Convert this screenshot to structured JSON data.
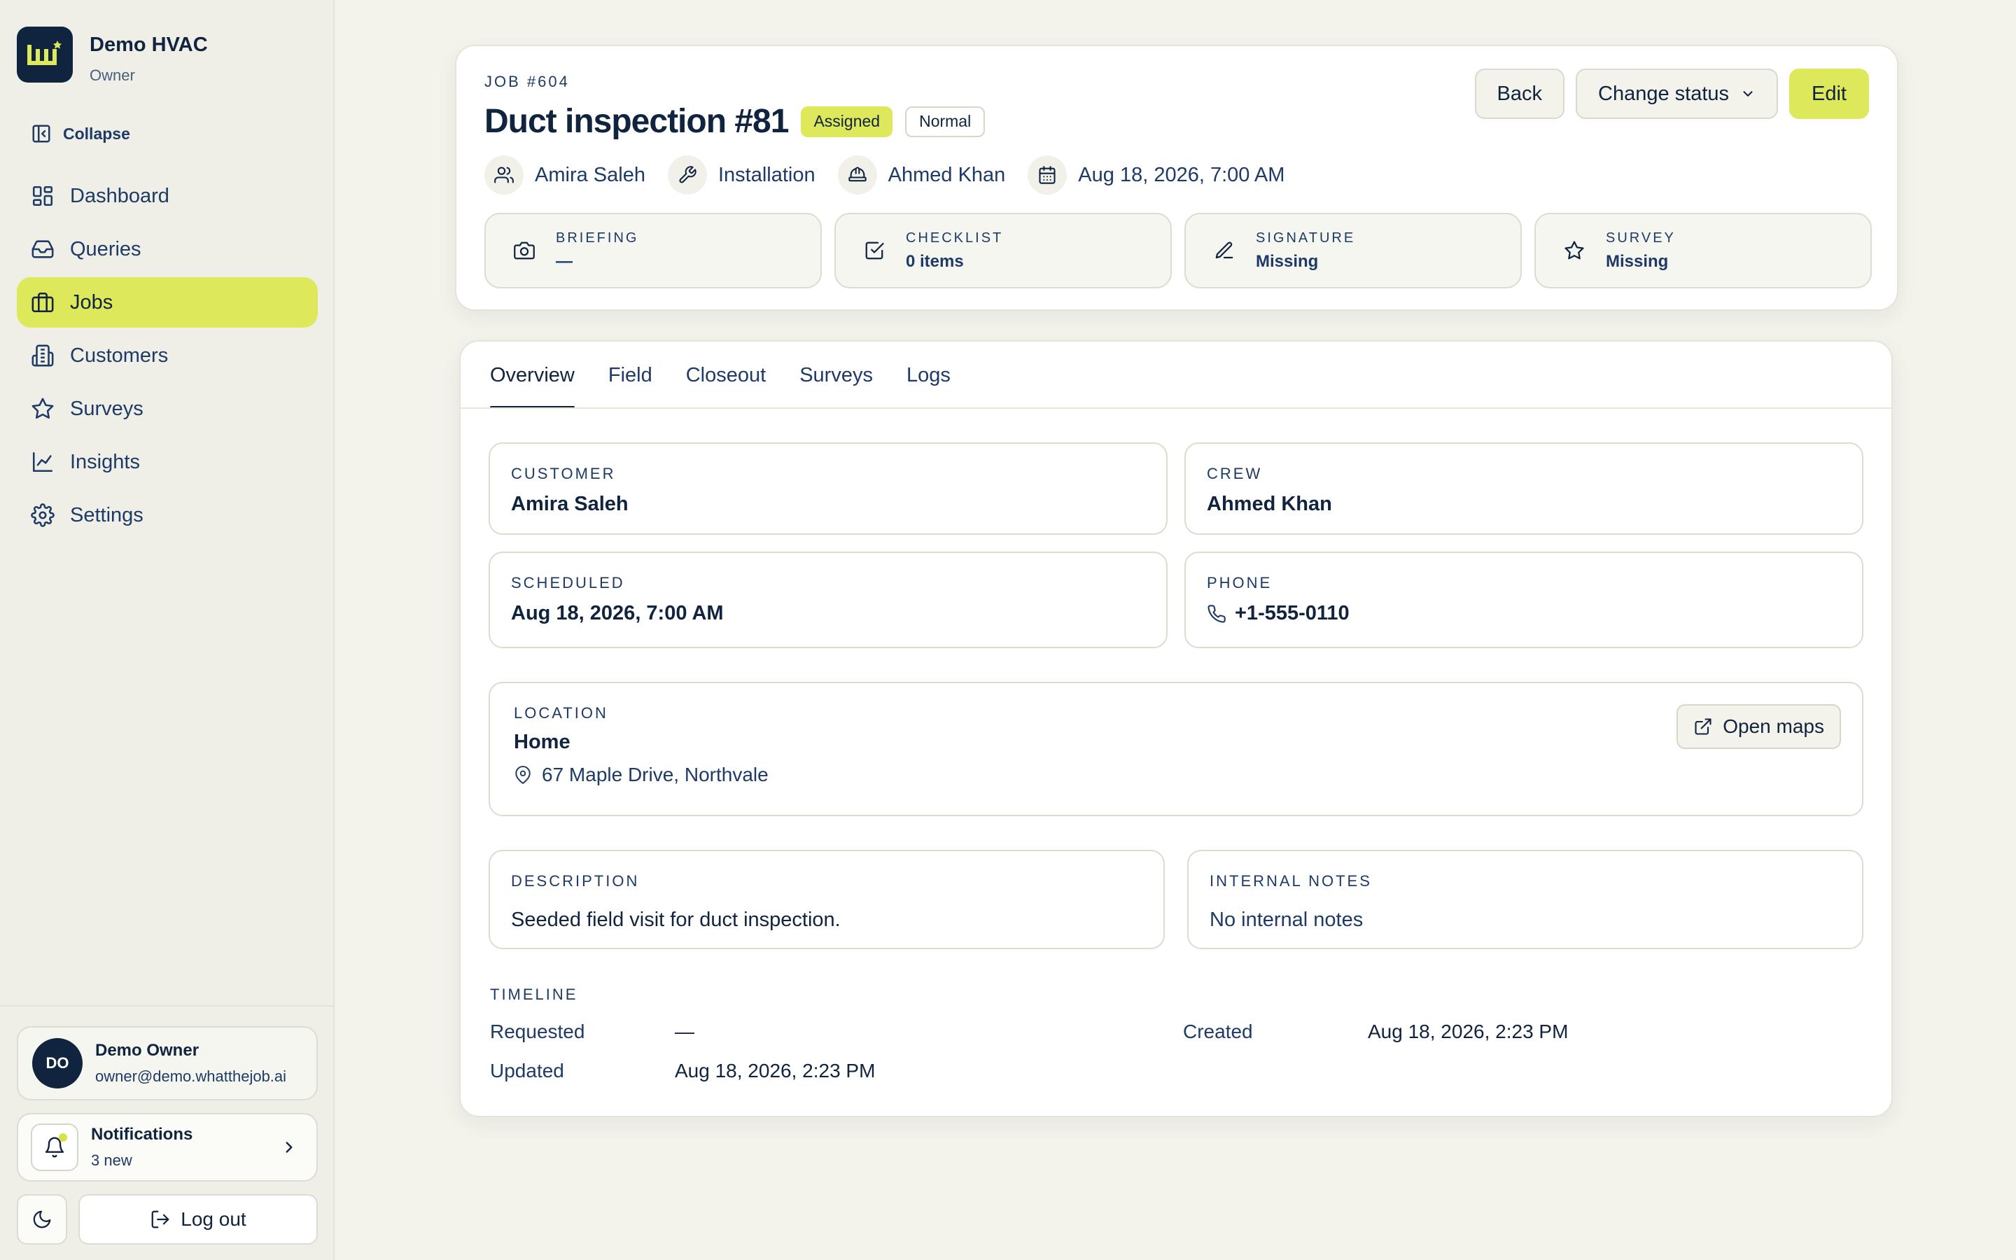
{
  "brand": {
    "name": "Demo HVAC",
    "role": "Owner"
  },
  "sidebar": {
    "collapse_label": "Collapse",
    "items": [
      {
        "label": "Dashboard",
        "icon": "dashboard-icon"
      },
      {
        "label": "Queries",
        "icon": "inbox-icon"
      },
      {
        "label": "Jobs",
        "icon": "briefcase-icon",
        "active": true
      },
      {
        "label": "Customers",
        "icon": "building-icon"
      },
      {
        "label": "Surveys",
        "icon": "star-icon"
      },
      {
        "label": "Insights",
        "icon": "chart-icon"
      },
      {
        "label": "Settings",
        "icon": "gear-icon"
      }
    ]
  },
  "user": {
    "initials": "DO",
    "name": "Demo Owner",
    "email": "owner@demo.whatthejob.ai"
  },
  "notifications": {
    "title": "Notifications",
    "count": "3 new"
  },
  "logout_label": "Log out",
  "job": {
    "number": "JOB #604",
    "title": "Duct inspection #81",
    "status": "Assigned",
    "priority": "Normal",
    "meta": {
      "customer": "Amira Saleh",
      "type": "Installation",
      "crew": "Ahmed Khan",
      "scheduled": "Aug 18, 2026, 7:00 AM"
    },
    "actions": {
      "back": "Back",
      "change_status": "Change status",
      "edit": "Edit"
    },
    "stats": [
      {
        "label": "BRIEFING",
        "value": "—",
        "icon": "camera-icon"
      },
      {
        "label": "CHECKLIST",
        "value": "0 items",
        "icon": "checkbox-icon"
      },
      {
        "label": "SIGNATURE",
        "value": "Missing",
        "icon": "pen-icon"
      },
      {
        "label": "SURVEY",
        "value": "Missing",
        "icon": "star-icon"
      }
    ]
  },
  "tabs": [
    "Overview",
    "Field",
    "Closeout",
    "Surveys",
    "Logs"
  ],
  "active_tab": "Overview",
  "overview": {
    "customer": {
      "label": "CUSTOMER",
      "value": "Amira Saleh"
    },
    "crew": {
      "label": "CREW",
      "value": "Ahmed Khan"
    },
    "scheduled": {
      "label": "SCHEDULED",
      "value": "Aug 18, 2026, 7:00 AM"
    },
    "phone": {
      "label": "PHONE",
      "value": "+1-555-0110"
    },
    "location": {
      "label": "LOCATION",
      "name": "Home",
      "address": "67 Maple Drive, Northvale",
      "maps_label": "Open maps"
    },
    "description": {
      "label": "DESCRIPTION",
      "value": "Seeded field visit for duct inspection."
    },
    "notes": {
      "label": "INTERNAL NOTES",
      "value": "No internal notes"
    },
    "timeline": {
      "label": "TIMELINE",
      "requested_label": "Requested",
      "requested": "—",
      "created_label": "Created",
      "created": "Aug 18, 2026, 2:23 PM",
      "updated_label": "Updated",
      "updated": "Aug 18, 2026, 2:23 PM"
    }
  },
  "colors": {
    "accent": "#dde85a",
    "navy": "#10233f",
    "text": "#1e3a66",
    "background": "#f3f3ec"
  }
}
